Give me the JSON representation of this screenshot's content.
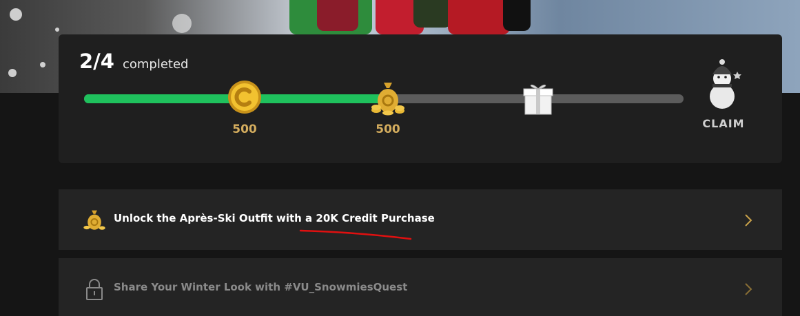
{
  "progress": {
    "completed_count": "2/4",
    "completed_label": "completed",
    "fraction_complete": 0.5,
    "rewards": [
      {
        "icon": "coin-icon",
        "value": "500"
      },
      {
        "icon": "coin-bag-icon",
        "value": "500"
      },
      {
        "icon": "gift-box-icon"
      }
    ],
    "claim": {
      "icon": "snowman-icon",
      "label": "CLAIM"
    }
  },
  "quests": [
    {
      "icon": "coin-bag-icon",
      "label": "Unlock the Après-Ski Outfit with a 20K Credit Purchase",
      "locked": false
    },
    {
      "icon": "lock-icon",
      "label": "Share Your Winter Look with #VU_SnowmiesQuest",
      "locked": true
    }
  ],
  "colors": {
    "progress_fill": "#1fc15d",
    "gold": "#d4ad5e",
    "annotation": "#e01010"
  }
}
